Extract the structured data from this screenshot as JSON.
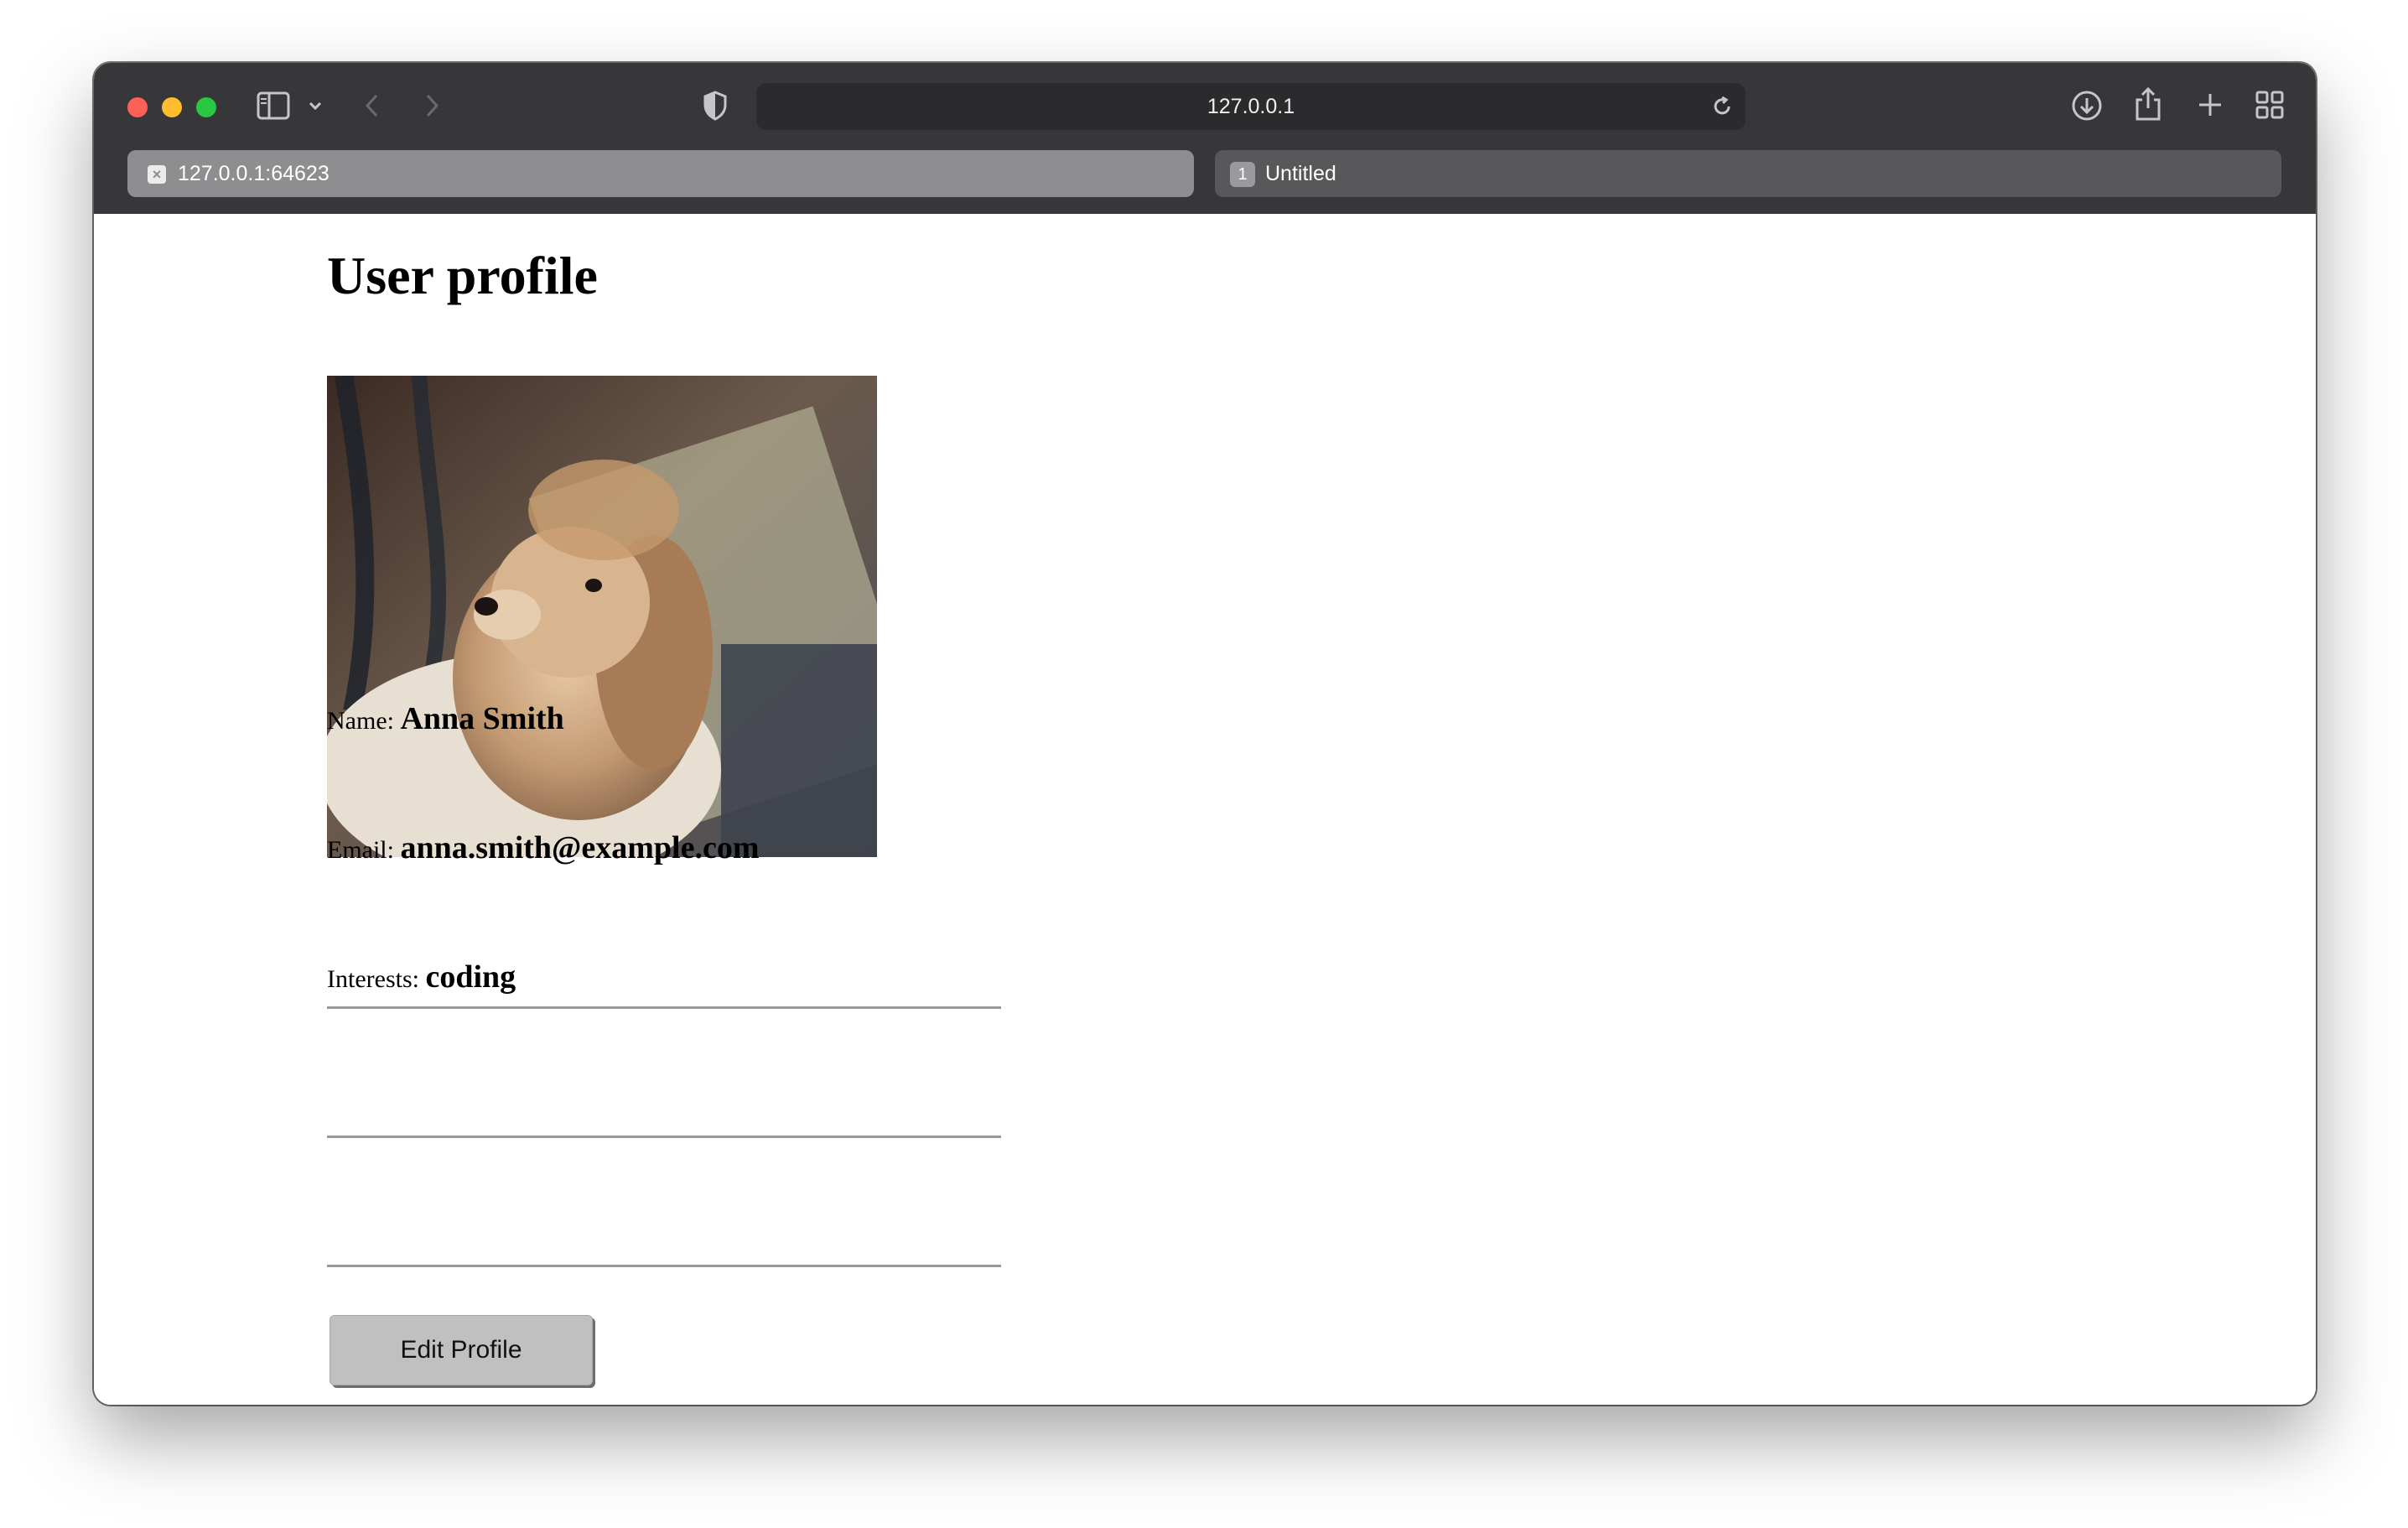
{
  "browser": {
    "address": "127.0.0.1",
    "tabs": [
      {
        "label": "127.0.0.1:64623",
        "active": true
      },
      {
        "label": "Untitled",
        "badge": "1",
        "active": false
      }
    ]
  },
  "page": {
    "title": "User profile",
    "fields": [
      {
        "label": "Name:",
        "value": "Anna Smith"
      },
      {
        "label": "Email:",
        "value": "anna.smith@example.com"
      },
      {
        "label": "Interests:",
        "value": "coding"
      }
    ],
    "edit_button": "Edit Profile"
  },
  "colors": {
    "toolbar": "#37373a",
    "active_tab": "#8e8e91",
    "inactive_tab": "#58585b",
    "button": "#c0c0c0"
  }
}
